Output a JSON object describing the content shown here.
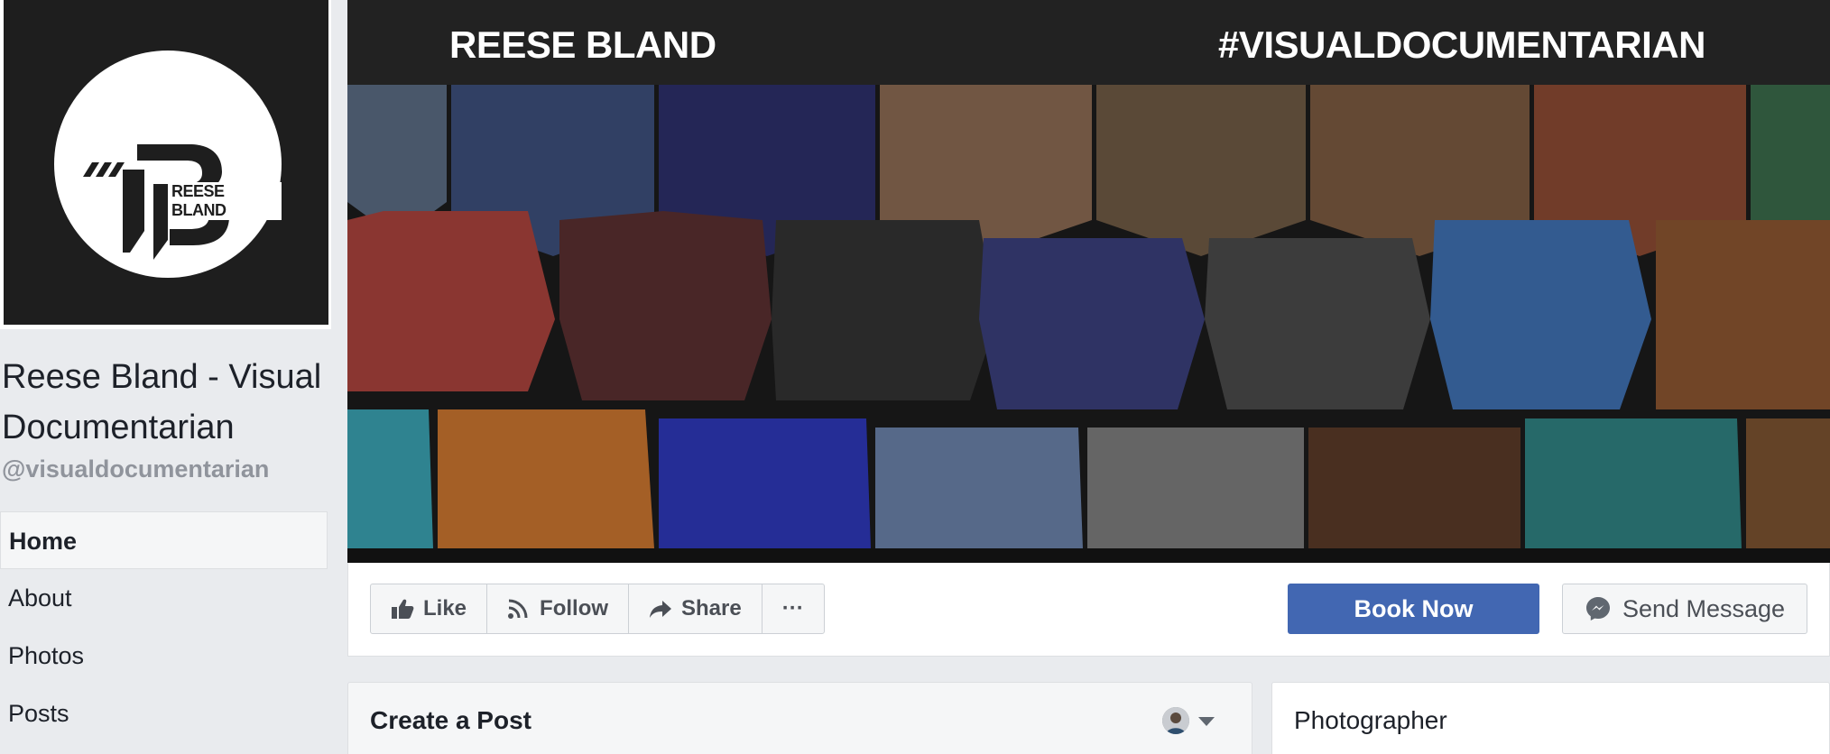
{
  "page": {
    "name": "Reese Bland - Visual Documentarian",
    "handle": "@visualdocumentarian",
    "logo_text": "REESE BLAND"
  },
  "nav": {
    "items": [
      "Home",
      "About",
      "Photos",
      "Posts"
    ],
    "active": "Home"
  },
  "cover": {
    "title_left": "REESE BLAND",
    "title_right": "#VISUALDOCUMENTARIAN"
  },
  "actions": {
    "like": "Like",
    "follow": "Follow",
    "share": "Share",
    "more": "···",
    "book_now": "Book Now",
    "send_message": "Send Message"
  },
  "create_post": {
    "title": "Create a Post"
  },
  "about_card": {
    "category": "Photographer"
  },
  "colors": {
    "brand_blue": "#4267b2",
    "background": "#e9ebee",
    "muted_text": "#90949c"
  }
}
